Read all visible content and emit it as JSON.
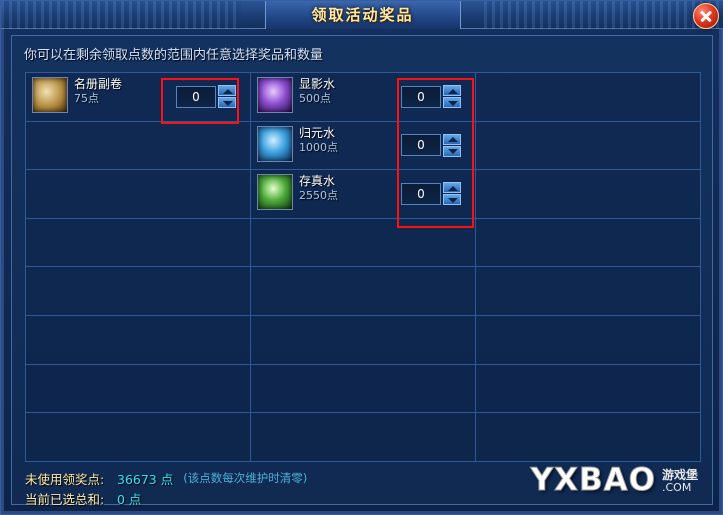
{
  "window": {
    "title": "领取活动奖品",
    "close_label": "×"
  },
  "hint": "你可以在剩余领取点数的范围内任意选择奖品和数量",
  "items": [
    {
      "name": "名册副卷",
      "cost": "75点",
      "value": "0",
      "icon": "book-icon",
      "col": 1
    },
    {
      "name": "显影水",
      "cost": "500点",
      "value": "0",
      "icon": "potion-purple-icon",
      "col": 2
    },
    {
      "name": "归元水",
      "cost": "1000点",
      "value": "0",
      "icon": "potion-blue-icon",
      "col": 2
    },
    {
      "name": "存真水",
      "cost": "2550点",
      "value": "0",
      "icon": "potion-green-icon",
      "col": 2
    }
  ],
  "footer": {
    "unused_label": "未使用领奖点:",
    "unused_value": "36673 点",
    "unused_note": "(该点数每次维护时清零)",
    "selected_label": "当前已选总和:",
    "selected_value": "0 点"
  },
  "watermark": {
    "main": "YXBAO",
    "sub_top": "游戏堡",
    "sub_bottom": ".COM"
  },
  "grid": {
    "rows": 8,
    "cols": 3
  }
}
